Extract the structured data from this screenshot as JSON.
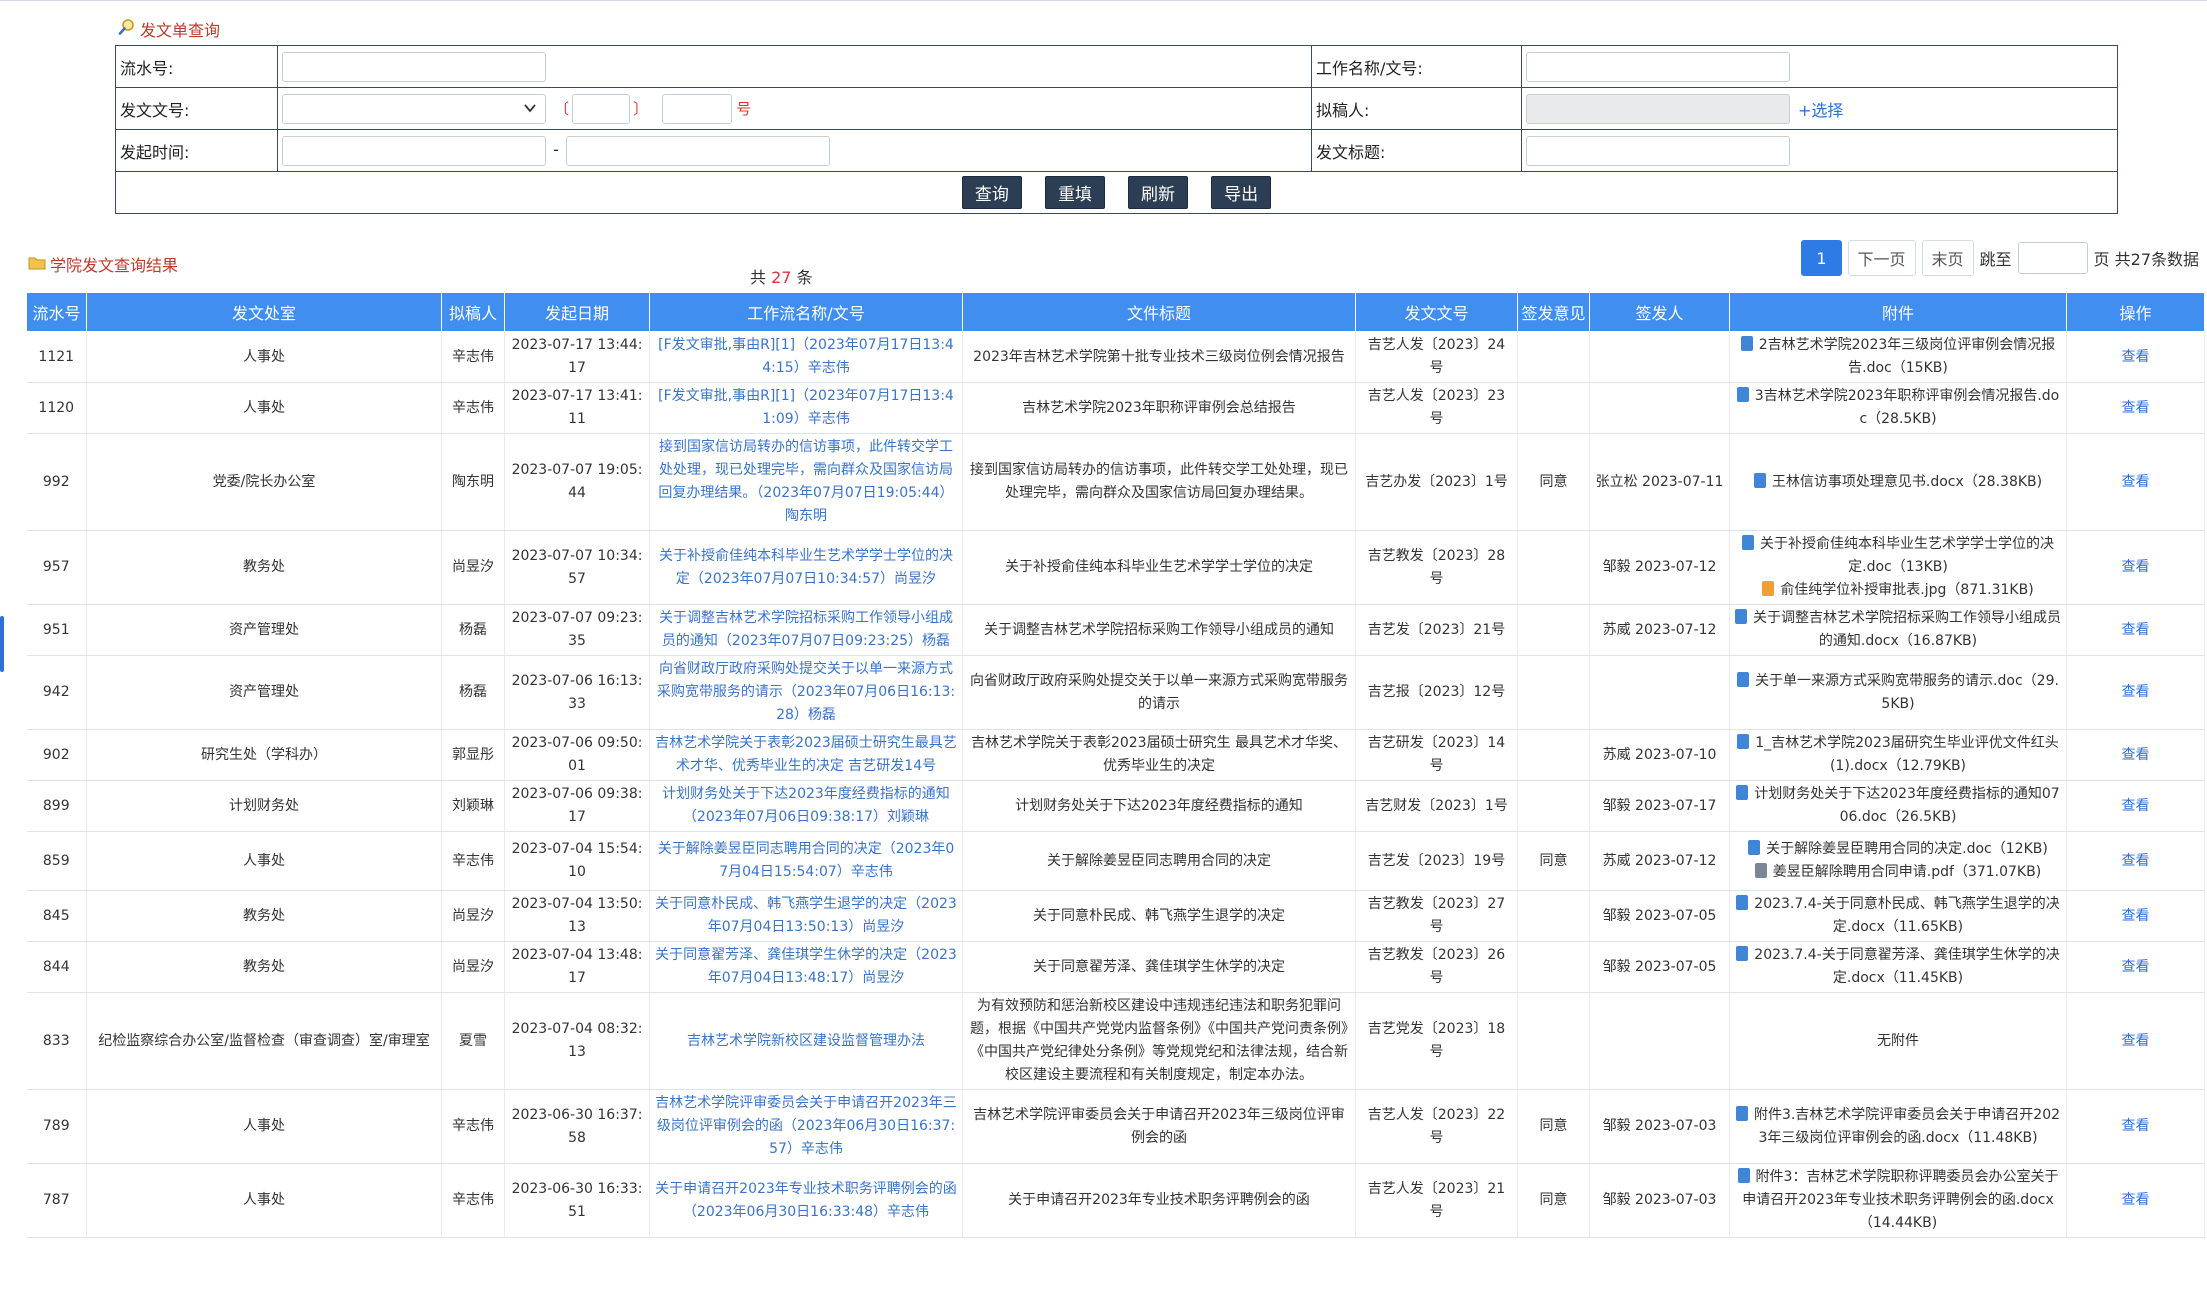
{
  "query": {
    "title": "发文单查询",
    "labels": {
      "serial": "流水号:",
      "work_name": "工作名称/文号:",
      "doc_number": "发文文号:",
      "drafter": "拟稿人:",
      "start_time": "发起时间:",
      "doc_title": "发文标题:"
    },
    "bracket_open": "〔",
    "bracket_close": "〕",
    "hao": "号",
    "dash": "-",
    "choose": "+选择",
    "buttons": [
      "查询",
      "重填",
      "刷新",
      "导出"
    ]
  },
  "results": {
    "title": "学院发文查询结果",
    "total_prefix": "共",
    "total_count": "27",
    "total_suffix": "条",
    "pager": {
      "current": "1",
      "next": "下一页",
      "last": "末页",
      "jump": "跳至",
      "suffix": "页 共27条数据"
    },
    "columns": [
      "流水号",
      "发文处室",
      "拟稿人",
      "发起日期",
      "工作流名称/文号",
      "文件标题",
      "发文文号",
      "签发意见",
      "签发人",
      "附件",
      "操作"
    ],
    "rows": [
      {
        "id": "1121",
        "dept": "人事处",
        "drafter": "辛志伟",
        "date": "2023-07-17 13:44:17",
        "flow": "[F发文审批,事由R][1]（2023年07月17日13:44:15）辛志伟",
        "title": "2023年吉林艺术学院第十批专业技术三级岗位例会情况报告",
        "num": "吉艺人发〔2023〕24号",
        "opinion": "",
        "signer": "",
        "attachments": [
          {
            "type": "doc",
            "name": "2吉林艺术学院2023年三级岗位评审例会情况报告.doc（15KB)"
          }
        ],
        "op": "查看"
      },
      {
        "id": "1120",
        "dept": "人事处",
        "drafter": "辛志伟",
        "date": "2023-07-17 13:41:11",
        "flow": "[F发文审批,事由R][1]（2023年07月17日13:41:09）辛志伟",
        "title": "吉林艺术学院2023年职称评审例会总结报告",
        "num": "吉艺人发〔2023〕23号",
        "opinion": "",
        "signer": "",
        "attachments": [
          {
            "type": "doc",
            "name": "3吉林艺术学院2023年职称评审例会情况报告.doc（28.5KB)"
          }
        ],
        "op": "查看"
      },
      {
        "id": "992",
        "dept": "党委/院长办公室",
        "drafter": "陶东明",
        "date": "2023-07-07 19:05:44",
        "flow": "接到国家信访局转办的信访事项，此件转交学工处处理，现已处理完毕，需向群众及国家信访局回复办理结果。（2023年07月07日19:05:44）陶东明",
        "title": "接到国家信访局转办的信访事项，此件转交学工处处理，现已处理完毕，需向群众及国家信访局回复办理结果。",
        "num": "吉艺办发〔2023〕1号",
        "opinion": "同意",
        "signer": "张立松 2023-07-11",
        "attachments": [
          {
            "type": "doc",
            "name": "王林信访事项处理意见书.docx（28.38KB)"
          }
        ],
        "op": "查看"
      },
      {
        "id": "957",
        "dept": "教务处",
        "drafter": "尚昱汐",
        "date": "2023-07-07 10:34:57",
        "flow": "关于补授俞佳纯本科毕业生艺术学学士学位的决定（2023年07月07日10:34:57）尚昱汐",
        "title": "关于补授俞佳纯本科毕业生艺术学学士学位的决定",
        "num": "吉艺教发〔2023〕28号",
        "opinion": "",
        "signer": "邹毅 2023-07-12",
        "attachments": [
          {
            "type": "doc",
            "name": "关于补授俞佳纯本科毕业生艺术学学士学位的决定.doc（13KB)"
          },
          {
            "type": "jpg",
            "name": "俞佳纯学位补授审批表.jpg（871.31KB)"
          }
        ],
        "op": "查看"
      },
      {
        "id": "951",
        "dept": "资产管理处",
        "drafter": "杨磊",
        "date": "2023-07-07 09:23:35",
        "flow": "关于调整吉林艺术学院招标采购工作领导小组成员的通知（2023年07月07日09:23:25）杨磊",
        "title": "关于调整吉林艺术学院招标采购工作领导小组成员的通知",
        "num": "吉艺发〔2023〕21号",
        "opinion": "",
        "signer": "苏威 2023-07-12",
        "attachments": [
          {
            "type": "doc",
            "name": "关于调整吉林艺术学院招标采购工作领导小组成员的通知.docx（16.87KB)"
          }
        ],
        "op": "查看"
      },
      {
        "id": "942",
        "dept": "资产管理处",
        "drafter": "杨磊",
        "date": "2023-07-06 16:13:33",
        "flow": "向省财政厅政府采购处提交关于以单一来源方式采购宽带服务的请示（2023年07月06日16:13:28）杨磊",
        "title": "向省财政厅政府采购处提交关于以单一来源方式采购宽带服务的请示",
        "num": "吉艺报〔2023〕12号",
        "opinion": "",
        "signer": "",
        "attachments": [
          {
            "type": "doc",
            "name": "关于单一来源方式采购宽带服务的请示.doc（29.5KB)"
          }
        ],
        "op": "查看"
      },
      {
        "id": "902",
        "dept": "研究生处（学科办）",
        "drafter": "郭显彤",
        "date": "2023-07-06 09:50:01",
        "flow": "吉林艺术学院关于表彰2023届硕士研究生最具艺术才华、优秀毕业生的决定 吉艺研发14号",
        "title": "吉林艺术学院关于表彰2023届硕士研究生 最具艺术才华奖、优秀毕业生的决定",
        "num": "吉艺研发〔2023〕14号",
        "opinion": "",
        "signer": "苏威 2023-07-10",
        "attachments": [
          {
            "type": "doc",
            "name": "1_吉林艺术学院2023届研究生毕业评优文件红头(1).docx（12.79KB)"
          }
        ],
        "op": "查看"
      },
      {
        "id": "899",
        "dept": "计划财务处",
        "drafter": "刘颖琳",
        "date": "2023-07-06 09:38:17",
        "flow": "计划财务处关于下达2023年度经费指标的通知（2023年07月06日09:38:17）刘颖琳",
        "title": "计划财务处关于下达2023年度经费指标的通知",
        "num": "吉艺财发〔2023〕1号",
        "opinion": "",
        "signer": "邹毅 2023-07-17",
        "attachments": [
          {
            "type": "doc",
            "name": "计划财务处关于下达2023年度经费指标的通知0706.doc（26.5KB)"
          }
        ],
        "op": "查看"
      },
      {
        "id": "859",
        "dept": "人事处",
        "drafter": "辛志伟",
        "date": "2023-07-04 15:54:10",
        "flow": "关于解除姜昱臣同志聘用合同的决定（2023年07月04日15:54:07）辛志伟",
        "title": "关于解除姜昱臣同志聘用合同的决定",
        "num": "吉艺发〔2023〕19号",
        "opinion": "同意",
        "signer": "苏威 2023-07-12",
        "attachments": [
          {
            "type": "doc",
            "name": "关于解除姜昱臣聘用合同的决定.doc（12KB)"
          },
          {
            "type": "pdf",
            "name": "姜昱臣解除聘用合同申请.pdf（371.07KB)"
          }
        ],
        "op": "查看"
      },
      {
        "id": "845",
        "dept": "教务处",
        "drafter": "尚昱汐",
        "date": "2023-07-04 13:50:13",
        "flow": "关于同意朴民成、韩飞燕学生退学的决定（2023年07月04日13:50:13）尚昱汐",
        "title": "关于同意朴民成、韩飞燕学生退学的决定",
        "num": "吉艺教发〔2023〕27号",
        "opinion": "",
        "signer": "邹毅 2023-07-05",
        "attachments": [
          {
            "type": "doc",
            "name": "2023.7.4-关于同意朴民成、韩飞燕学生退学的决定.docx（11.65KB)"
          }
        ],
        "op": "查看"
      },
      {
        "id": "844",
        "dept": "教务处",
        "drafter": "尚昱汐",
        "date": "2023-07-04 13:48:17",
        "flow": "关于同意翟芳泽、龚佳琪学生休学的决定（2023年07月04日13:48:17）尚昱汐",
        "title": "关于同意翟芳泽、龚佳琪学生休学的决定",
        "num": "吉艺教发〔2023〕26号",
        "opinion": "",
        "signer": "邹毅 2023-07-05",
        "attachments": [
          {
            "type": "doc",
            "name": "2023.7.4-关于同意翟芳泽、龚佳琪学生休学的决定.docx（11.45KB)"
          }
        ],
        "op": "查看"
      },
      {
        "id": "833",
        "dept": "纪检监察综合办公室/监督检查（审查调查）室/审理室",
        "drafter": "夏雪",
        "date": "2023-07-04 08:32:13",
        "flow": "吉林艺术学院新校区建设监督管理办法",
        "title": "为有效预防和惩治新校区建设中违规违纪违法和职务犯罪问题，根据《中国共产党党内监督条例》《中国共产党问责条例》《中国共产党纪律处分条例》等党规党纪和法律法规，结合新校区建设主要流程和有关制度规定，制定本办法。",
        "num": "吉艺党发〔2023〕18号",
        "opinion": "",
        "signer": "",
        "attachments": [],
        "no_attachment": "无附件",
        "op": "查看"
      },
      {
        "id": "789",
        "dept": "人事处",
        "drafter": "辛志伟",
        "date": "2023-06-30 16:37:58",
        "flow": "吉林艺术学院评审委员会关于申请召开2023年三级岗位评审例会的函（2023年06月30日16:37:57）辛志伟",
        "title": "吉林艺术学院评审委员会关于申请召开2023年三级岗位评审例会的函",
        "num": "吉艺人发〔2023〕22号",
        "opinion": "同意",
        "signer": "邹毅 2023-07-03",
        "attachments": [
          {
            "type": "doc",
            "name": "附件3.吉林艺术学院评审委员会关于申请召开2023年三级岗位评审例会的函.docx（11.48KB)"
          }
        ],
        "op": "查看"
      },
      {
        "id": "787",
        "dept": "人事处",
        "drafter": "辛志伟",
        "date": "2023-06-30 16:33:51",
        "flow": "关于申请召开2023年专业技术职务评聘例会的函（2023年06月30日16:33:48）辛志伟",
        "title": "关于申请召开2023年专业技术职务评聘例会的函",
        "num": "吉艺人发〔2023〕21号",
        "opinion": "同意",
        "signer": "邹毅 2023-07-03",
        "attachments": [
          {
            "type": "doc",
            "name": "附件3：吉林艺术学院职称评聘委员会办公室关于申请召开2023年专业技术职务评聘例会的函.docx（14.44KB)"
          }
        ],
        "op": "查看"
      }
    ]
  }
}
